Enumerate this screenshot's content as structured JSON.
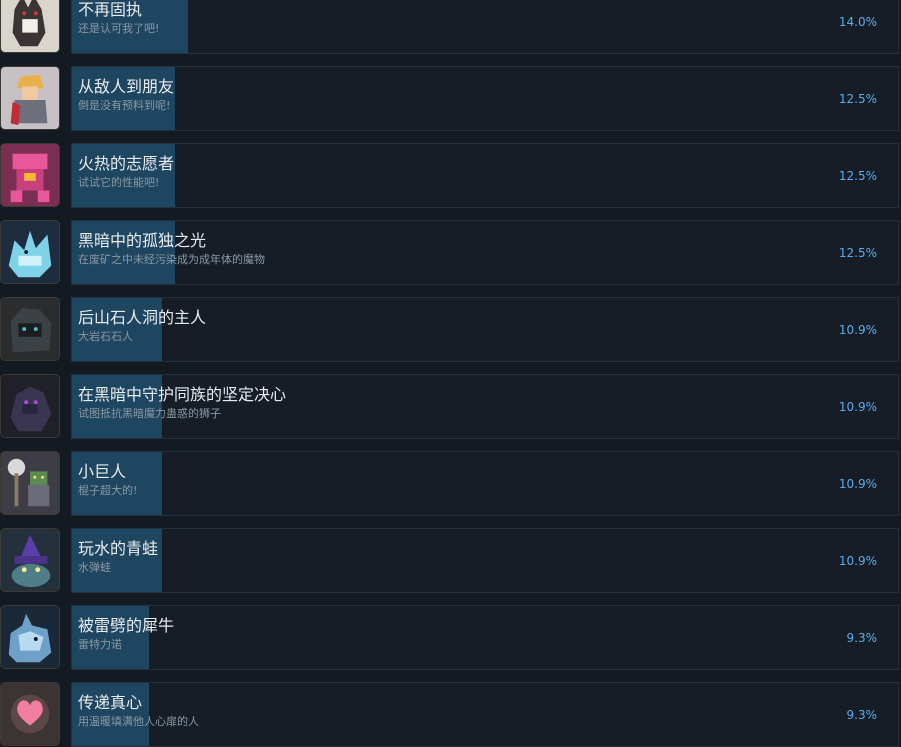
{
  "achievements": [
    {
      "title": "不再固执",
      "desc": "还是认可我了吧!",
      "percent_label": "14.0%",
      "percent": 14.0,
      "icon": "werewolf-icon"
    },
    {
      "title": "从敌人到朋友",
      "desc": "倒是没有预料到呢!",
      "percent_label": "12.5%",
      "percent": 12.5,
      "icon": "blonde-warrior-icon"
    },
    {
      "title": "火热的志愿者",
      "desc": "试试它的性能吧!",
      "percent_label": "12.5%",
      "percent": 12.5,
      "icon": "pink-mech-icon"
    },
    {
      "title": "黑暗中的孤独之光",
      "desc": "在废矿之中未经污染成为成年体的魔物",
      "percent_label": "12.5%",
      "percent": 12.5,
      "icon": "crystal-beast-icon"
    },
    {
      "title": "后山石人洞的主人",
      "desc": "大岩石石人",
      "percent_label": "10.9%",
      "percent": 10.9,
      "icon": "rock-golem-icon"
    },
    {
      "title": "在黑暗中守护同族的坚定决心",
      "desc": "试图抵抗黑暗魔力蛊惑的狮子",
      "percent_label": "10.9%",
      "percent": 10.9,
      "icon": "shadow-lion-icon"
    },
    {
      "title": "小巨人",
      "desc": "棍子超大的!",
      "percent_label": "10.9%",
      "percent": 10.9,
      "icon": "goblin-club-icon"
    },
    {
      "title": "玩水的青蛙",
      "desc": "水弹蛙",
      "percent_label": "10.9%",
      "percent": 10.9,
      "icon": "wizard-frog-icon"
    },
    {
      "title": "被雷劈的犀牛",
      "desc": "雷特力诺",
      "percent_label": "9.3%",
      "percent": 9.3,
      "icon": "thunder-rhino-icon"
    },
    {
      "title": "传递真心",
      "desc": "用温暖填满他人心扉的人",
      "percent_label": "9.3%",
      "percent": 9.3,
      "icon": "heart-icon"
    }
  ],
  "colors": {
    "background": "#131a22",
    "panel": "#161d26",
    "progress_fill": "#1f4660",
    "percent_text": "#57aef0"
  }
}
